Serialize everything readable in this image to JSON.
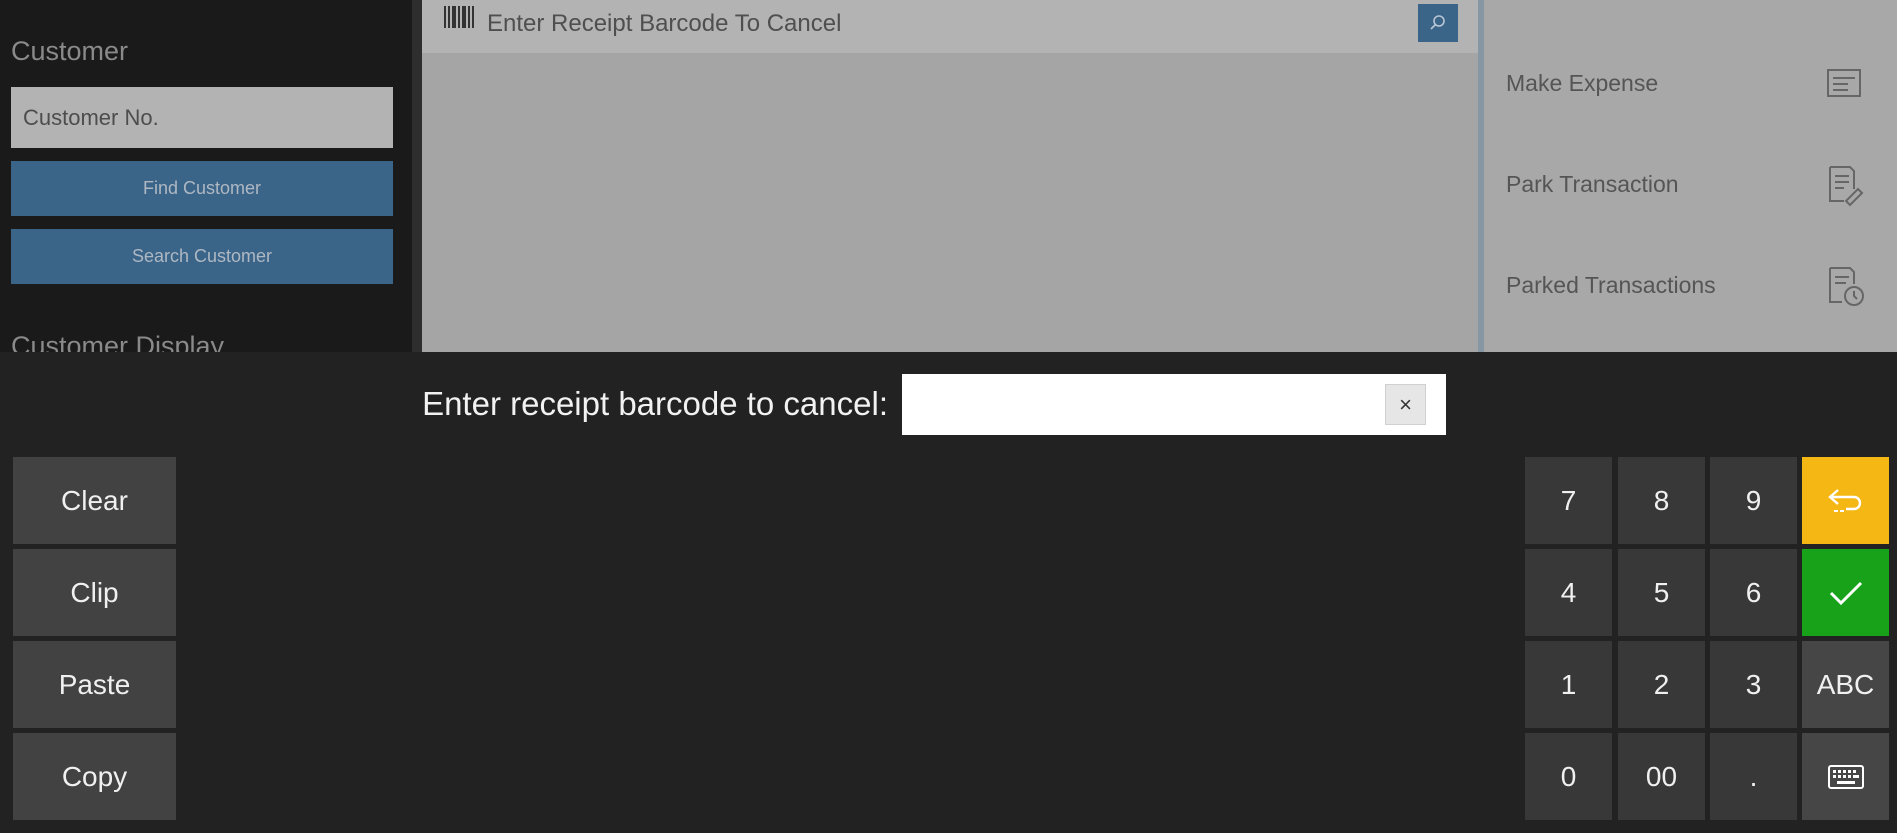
{
  "left_panel": {
    "customer_title": "Customer",
    "customer_input_placeholder": "Customer No.",
    "find_button": "Find Customer",
    "search_button": "Search Customer",
    "display_title": "Customer Display"
  },
  "center_panel": {
    "barcode_placeholder": "Enter Receipt Barcode To Cancel",
    "barcode_icon": "barcode-icon",
    "search_icon": "search-icon"
  },
  "right_panel": {
    "actions": [
      {
        "label": "Make Expense",
        "icon": "expense-icon"
      },
      {
        "label": "Park Transaction",
        "icon": "park-transaction-icon"
      },
      {
        "label": "Parked Transactions",
        "icon": "parked-transactions-icon"
      }
    ]
  },
  "keyboard": {
    "prompt": "Enter receipt barcode to cancel:",
    "input_value": "",
    "clear_input_glyph": "×",
    "side_buttons": [
      "Clear",
      "Clip",
      "Paste",
      "Copy"
    ],
    "numpad": [
      [
        "7",
        "8",
        "9"
      ],
      [
        "4",
        "5",
        "6"
      ],
      [
        "1",
        "2",
        "3"
      ],
      [
        "0",
        "00",
        "."
      ]
    ],
    "function_keys": {
      "back_icon": "return-arrow-icon",
      "confirm_icon": "checkmark-icon",
      "abc_label": "ABC",
      "keyboard_icon": "keyboard-icon"
    }
  },
  "colors": {
    "accent_blue": "#3b6489",
    "back_key": "#f5b714",
    "confirm_key": "#17a21a",
    "overlay_bg": "#222222"
  }
}
